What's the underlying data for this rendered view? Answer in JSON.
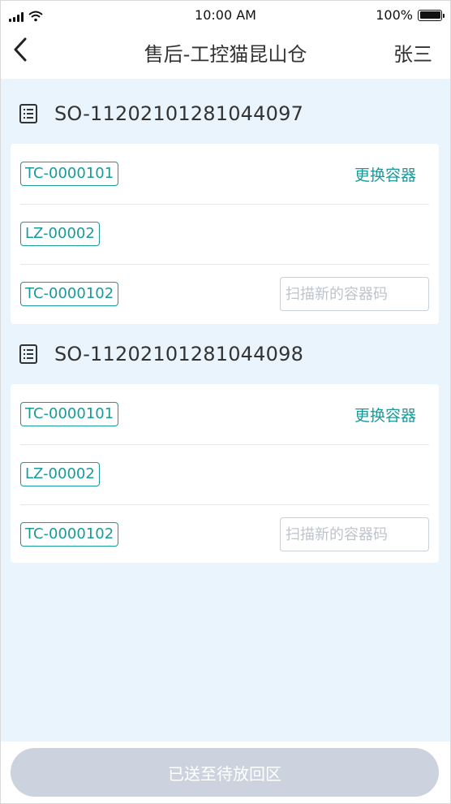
{
  "status_bar": {
    "time": "10:00 AM",
    "battery": "100%"
  },
  "nav": {
    "title": "售后-工控猫昆山仓",
    "user": "张三"
  },
  "orders": [
    {
      "order_no": "SO-11202101281044097",
      "rows": [
        {
          "tag": "TC-0000101",
          "action": "更换容器"
        },
        {
          "tag": "LZ-00002"
        },
        {
          "tag": "TC-0000102",
          "input_placeholder": "扫描新的容器码",
          "input_value": ""
        }
      ]
    },
    {
      "order_no": "SO-11202101281044098",
      "rows": [
        {
          "tag": "TC-0000101",
          "action": "更换容器"
        },
        {
          "tag": "LZ-00002"
        },
        {
          "tag": "TC-0000102",
          "input_placeholder": "扫描新的容器码",
          "input_value": ""
        }
      ]
    }
  ],
  "footer": {
    "submit_label": "已送至待放回区"
  },
  "colors": {
    "accent": "#1a9a9a",
    "page_bg": "#eaf4fc",
    "disabled_button": "#cdd3de"
  }
}
